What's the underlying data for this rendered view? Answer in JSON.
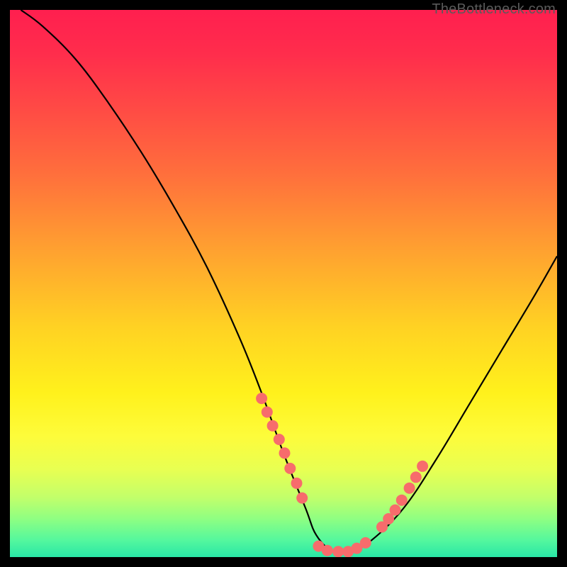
{
  "watermark": "TheBottleneck.com",
  "chart_data": {
    "type": "line",
    "title": "",
    "xlabel": "",
    "ylabel": "",
    "xlim": [
      0,
      100
    ],
    "ylim": [
      0,
      100
    ],
    "grid": false,
    "legend": "none",
    "series": [
      {
        "name": "bottleneck-curve",
        "x": [
          2,
          6,
          12,
          18,
          24,
          30,
          36,
          42,
          46,
          50,
          54,
          56,
          59,
          62,
          66,
          72,
          78,
          84,
          90,
          96,
          100
        ],
        "y": [
          100,
          97,
          91,
          83,
          74,
          64,
          53,
          40,
          30,
          19,
          9,
          4,
          1,
          1,
          3,
          9,
          18,
          28,
          38,
          48,
          55
        ]
      }
    ],
    "highlight_segments": [
      {
        "name": "left-dots",
        "x": [
          46.0,
          47.0,
          48.0,
          49.2,
          50.2,
          51.2,
          52.4,
          53.4
        ],
        "y": [
          29.0,
          26.5,
          24.0,
          21.5,
          19.0,
          16.2,
          13.5,
          10.8
        ]
      },
      {
        "name": "valley-dots",
        "x": [
          56.4,
          58.0,
          60.0,
          61.8,
          63.4,
          65.0
        ],
        "y": [
          2.0,
          1.2,
          1.0,
          1.0,
          1.6,
          2.6
        ]
      },
      {
        "name": "right-dots",
        "x": [
          68.0,
          69.2,
          70.4,
          71.6,
          73.0,
          74.2,
          75.4
        ],
        "y": [
          5.5,
          7.0,
          8.6,
          10.4,
          12.6,
          14.6,
          16.6
        ]
      }
    ],
    "colors": {
      "curve": "#000000",
      "dots": "#f76c6c",
      "gradient_top": "#ff1f4f",
      "gradient_bottom": "#29e6a6"
    }
  }
}
